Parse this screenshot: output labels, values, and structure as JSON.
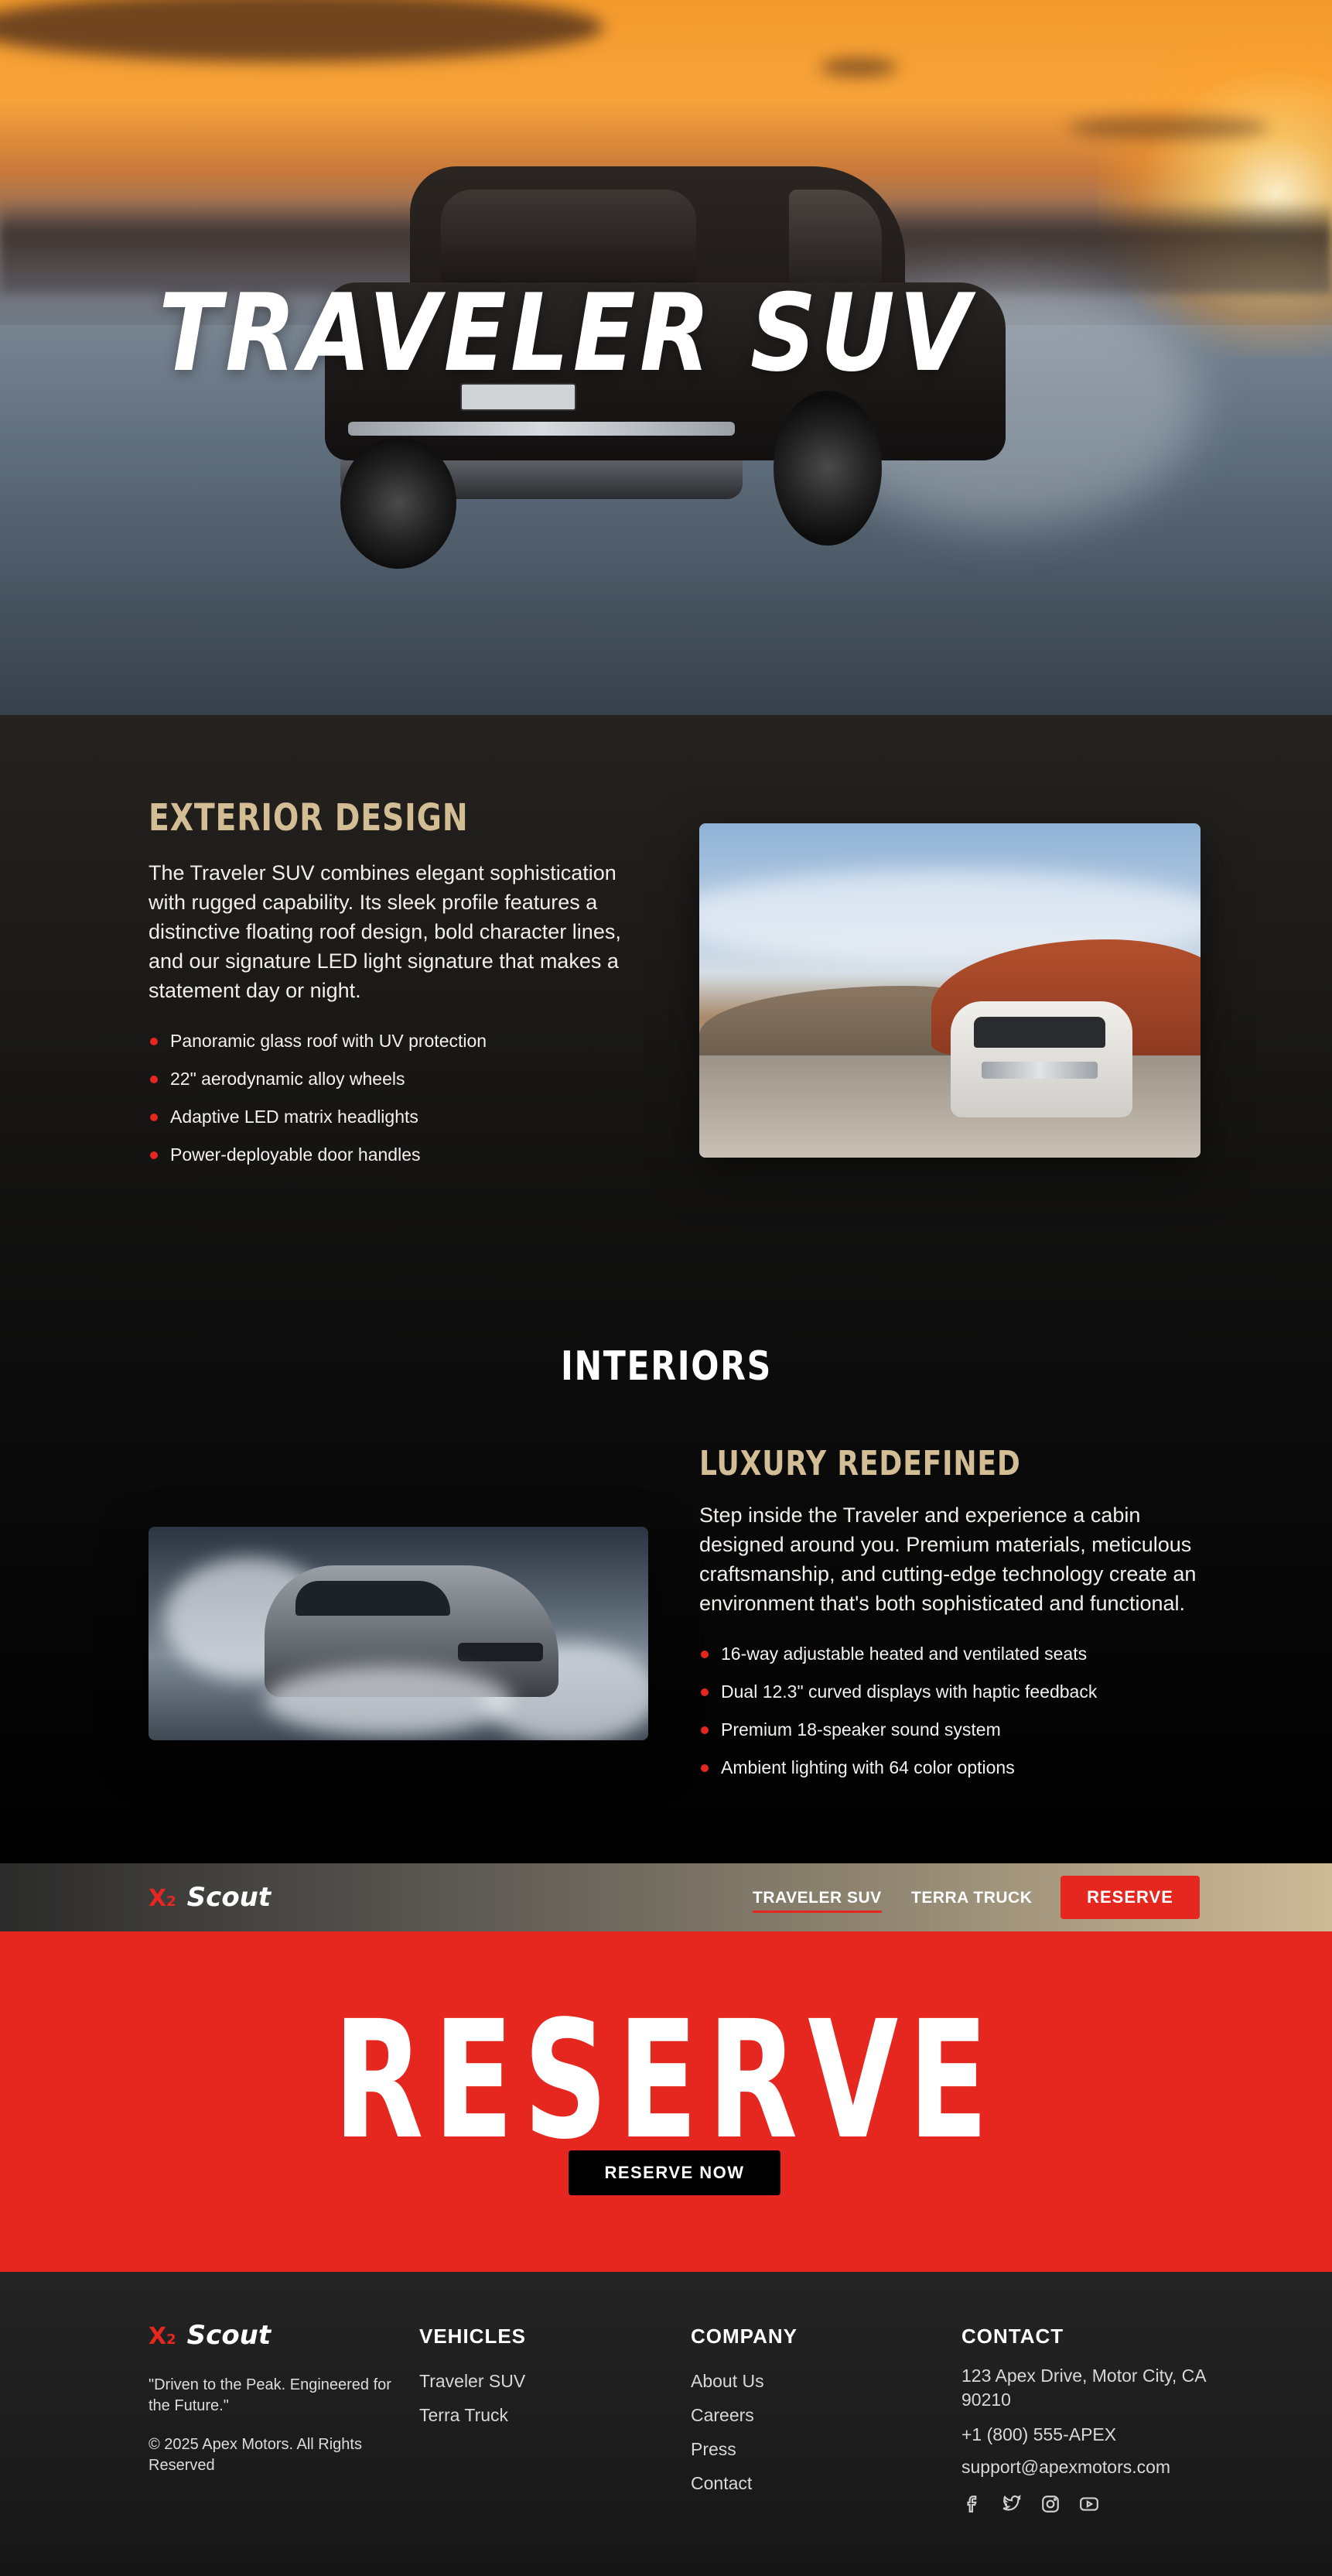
{
  "hero": {
    "title": "TRAVELER SUV"
  },
  "exterior": {
    "heading": "EXTERIOR DESIGN",
    "body": "The Traveler SUV combines elegant sophistication with rugged capability. Its sleek profile features a distinctive floating roof design, bold character lines, and our signature LED light signature that makes a statement day or night.",
    "features": [
      "Panoramic glass roof with UV protection",
      "22\" aerodynamic alloy wheels",
      "Adaptive LED matrix headlights",
      "Power-deployable door handles"
    ]
  },
  "interiors": {
    "section_title": "INTERIORS",
    "heading": "LUXURY REDEFINED",
    "body": "Step inside the Traveler and experience a cabin designed around you. Premium materials, meticulous craftsmanship, and cutting-edge technology create an environment that's both sophisticated and functional.",
    "features": [
      "16-way adjustable heated and ventilated seats",
      "Dual 12.3\" curved displays with haptic feedback",
      "Premium 18-speaker sound system",
      "Ambient lighting with 64 color options"
    ]
  },
  "brand": {
    "mark": "X",
    "sub": "2",
    "name": "Scout"
  },
  "nav": {
    "links": [
      "TRAVELER SUV",
      "TERRA TRUCK"
    ],
    "active_index": 0,
    "cta": "RESERVE"
  },
  "reserve": {
    "title": "RESERVE",
    "button": "RESERVE NOW"
  },
  "footer": {
    "tagline": "\"Driven to the Peak. Engineered for the Future.\"",
    "copyright": "© 2025 Apex Motors. All Rights Reserved",
    "vehicles": {
      "heading": "VEHICLES",
      "links": [
        "Traveler SUV",
        "Terra Truck"
      ]
    },
    "company": {
      "heading": "COMPANY",
      "links": [
        "About Us",
        "Careers",
        "Press",
        "Contact"
      ]
    },
    "contact": {
      "heading": "CONTACT",
      "address": "123 Apex Drive, Motor City, CA 90210",
      "phone": "+1 (800) 555-APEX",
      "email": "support@apexmotors.com",
      "socials": [
        "facebook-icon",
        "twitter-icon",
        "instagram-icon",
        "youtube-icon"
      ]
    }
  },
  "colors": {
    "accent_red": "#e5271f",
    "gold": "#d3bd94"
  }
}
